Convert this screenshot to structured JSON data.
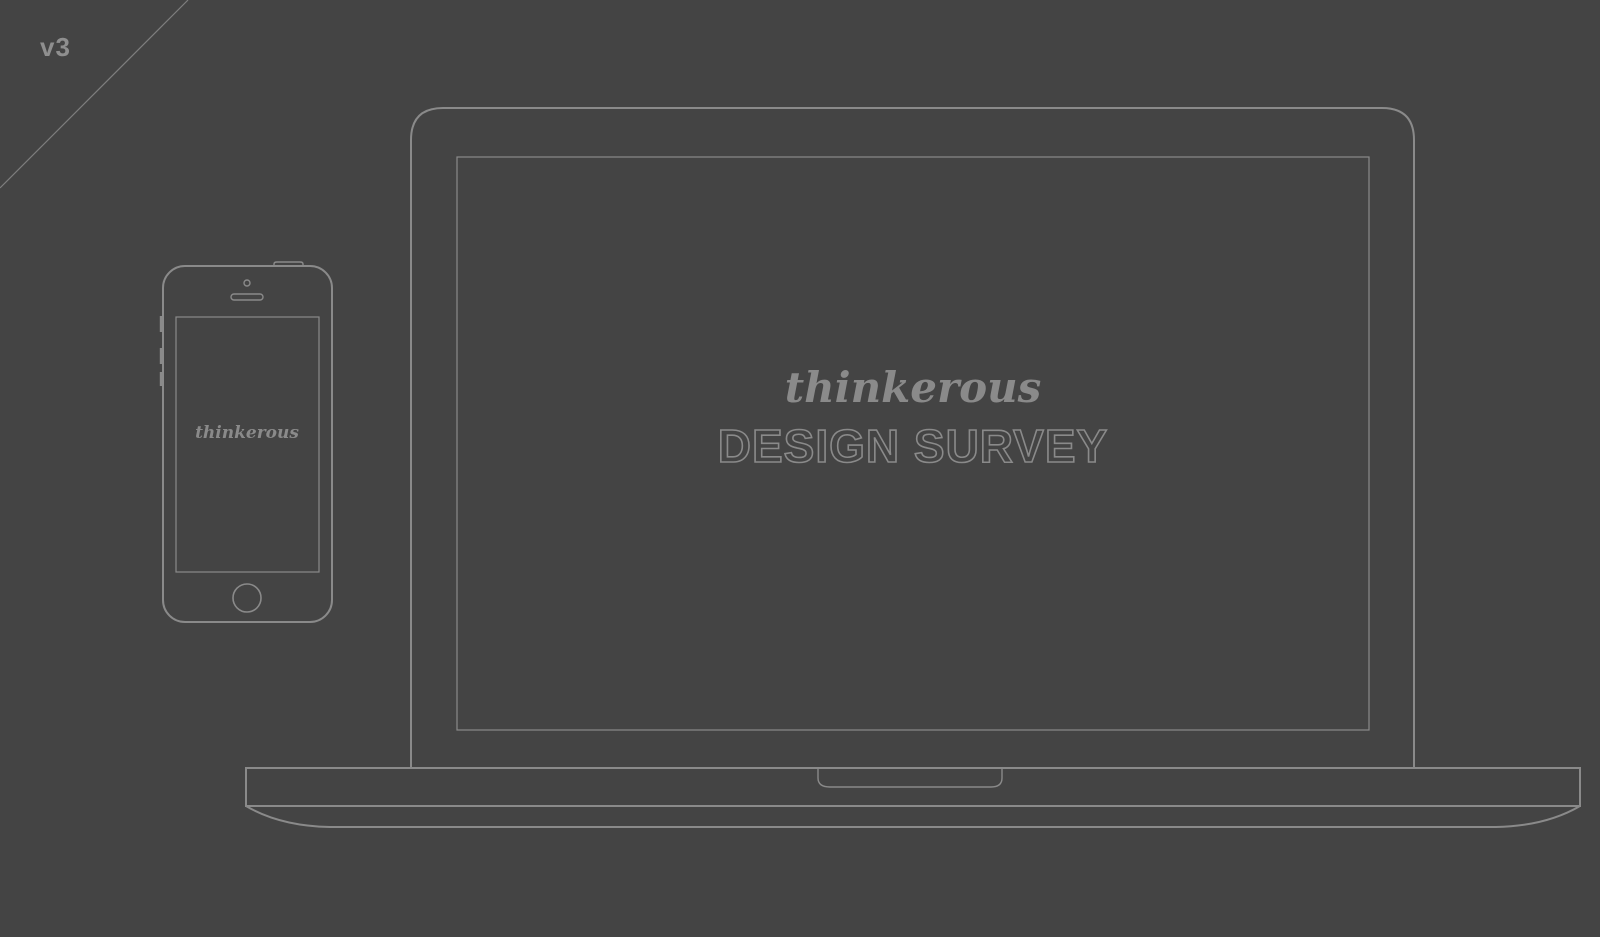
{
  "version": "v3",
  "laptop_screen": {
    "brand": "thinkerous",
    "title": "DESIGN SURVEY"
  },
  "phone_screen": {
    "brand": "thinkerous"
  },
  "colors": {
    "background": "#444444",
    "line": "#8a8a8a",
    "text": "#8a8a8a"
  }
}
